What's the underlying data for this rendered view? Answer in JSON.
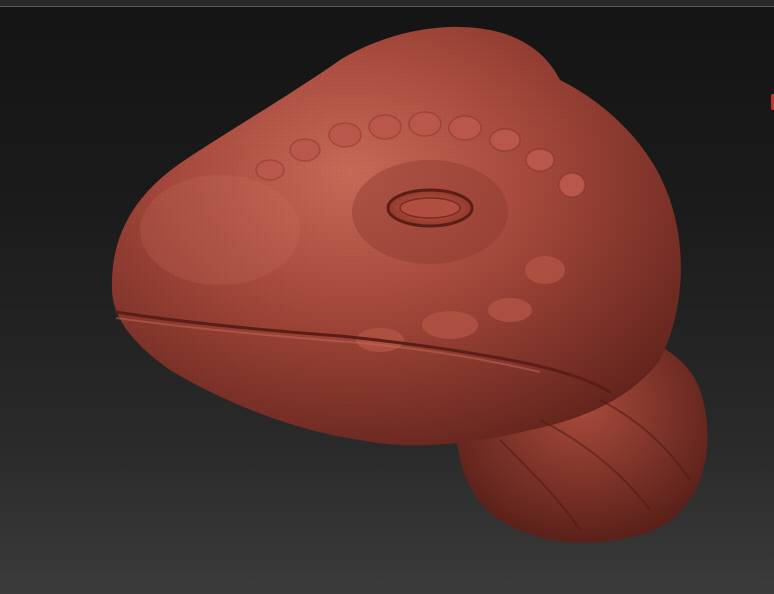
{
  "viewport": {
    "background_top": "#141414",
    "background_bottom": "#3b3b3b",
    "edge_marker_color": "#c2352a"
  },
  "model": {
    "material_color": "#a3473a",
    "highlight_color": "#c86a58",
    "shadow_color": "#5e211a",
    "icon": "sculpted-lizard-head"
  }
}
